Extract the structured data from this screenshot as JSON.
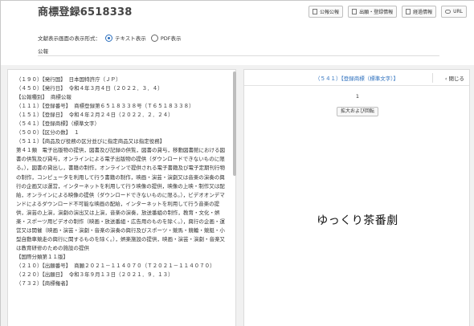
{
  "header": {
    "title": "商標登録6518338",
    "buttons": [
      {
        "label": "公報公報",
        "icon": "document-icon"
      },
      {
        "label": "出願・登録情報",
        "icon": "document-icon"
      },
      {
        "label": "経過情報",
        "icon": "document-icon"
      },
      {
        "label": "URL",
        "icon": "link-icon"
      }
    ]
  },
  "format": {
    "label": "文献表示画面の表示形式：",
    "options": [
      {
        "label": "テキスト表示",
        "selected": true
      },
      {
        "label": "PDF表示",
        "selected": false
      }
    ]
  },
  "publication_label": "公報",
  "document": {
    "lines": [
      "（１９０）【発行国】 日本国特許庁（ＪＰ）",
      "（４５０）【発行日】 令和４年３月４日（２０２２．３．４）",
      "【公報種別】 商標公報",
      "（１１１）【登録番号】 商標登録第６５１８３３８号（Ｔ６５１８３３８）",
      "（１５１）【登録日】 令和４年２月２４日（２０２２．２．２４）",
      "（５４１）【登録商標】（標準文字）",
      "（５００）【区分の数】 １",
      "（５１１）【商品及び役務の区分並びに指定商品又は指定役務】",
      "第４１類　電子出版物の提供，図書及び記録の供覧，図書の貸与，移動図書館における図書の供覧及び貸与，オンラインによる電子出版物の提供（ダウンロードできないものに限る。），図書の貸出し，書籍の制作，オンラインで提供される電子書籍及び電子定期刊行物の制作，コンピュータを利用して行う書籍の制作，映画・演芸・演劇又は音楽の演奏の興行の企画又は運営，インターネットを利用して行う映像の提供，映像の上映・制作又は配給，オンラインによる映像の提供（ダウンロードできないものに限る。），ビデオオンデマンドによるダウンロード不可能な映画の配給，インターネットを利用して行う音楽の提供，演芸の上演，演劇の演出又は上演，音楽の演奏，放送番組の制作，教育・文化・娯楽・スポーツ用ビデオの制作（映画・放送番組・広告用のものを除く。），興行の企画・運営又は開催（映画・演芸・演劇・音楽の演奏の興行及びスポーツ・競馬・競輪・競艇・小型自動車競走の興行に関するものを除く。），娯楽施設の提供，映画・演芸・演劇・音楽又は教育研修のための施設の提供",
      "【国際分類第１１版】",
      "（２１０）【出願番号】 商願２０２１－１１４０７０（Ｔ２０２１－１１４０７０）",
      "（２２０）【出願日】 令和３年９月１３日（２０２１．９．１３）",
      "（７３２）【商標権者】"
    ]
  },
  "viewer": {
    "heading": "（５４１）【登録商標（標準文字）】",
    "close_label": "閉じる",
    "page_number": "1",
    "zoom_label": "拡大および回転",
    "trademark_text": "ゆっくり茶番劇"
  }
}
